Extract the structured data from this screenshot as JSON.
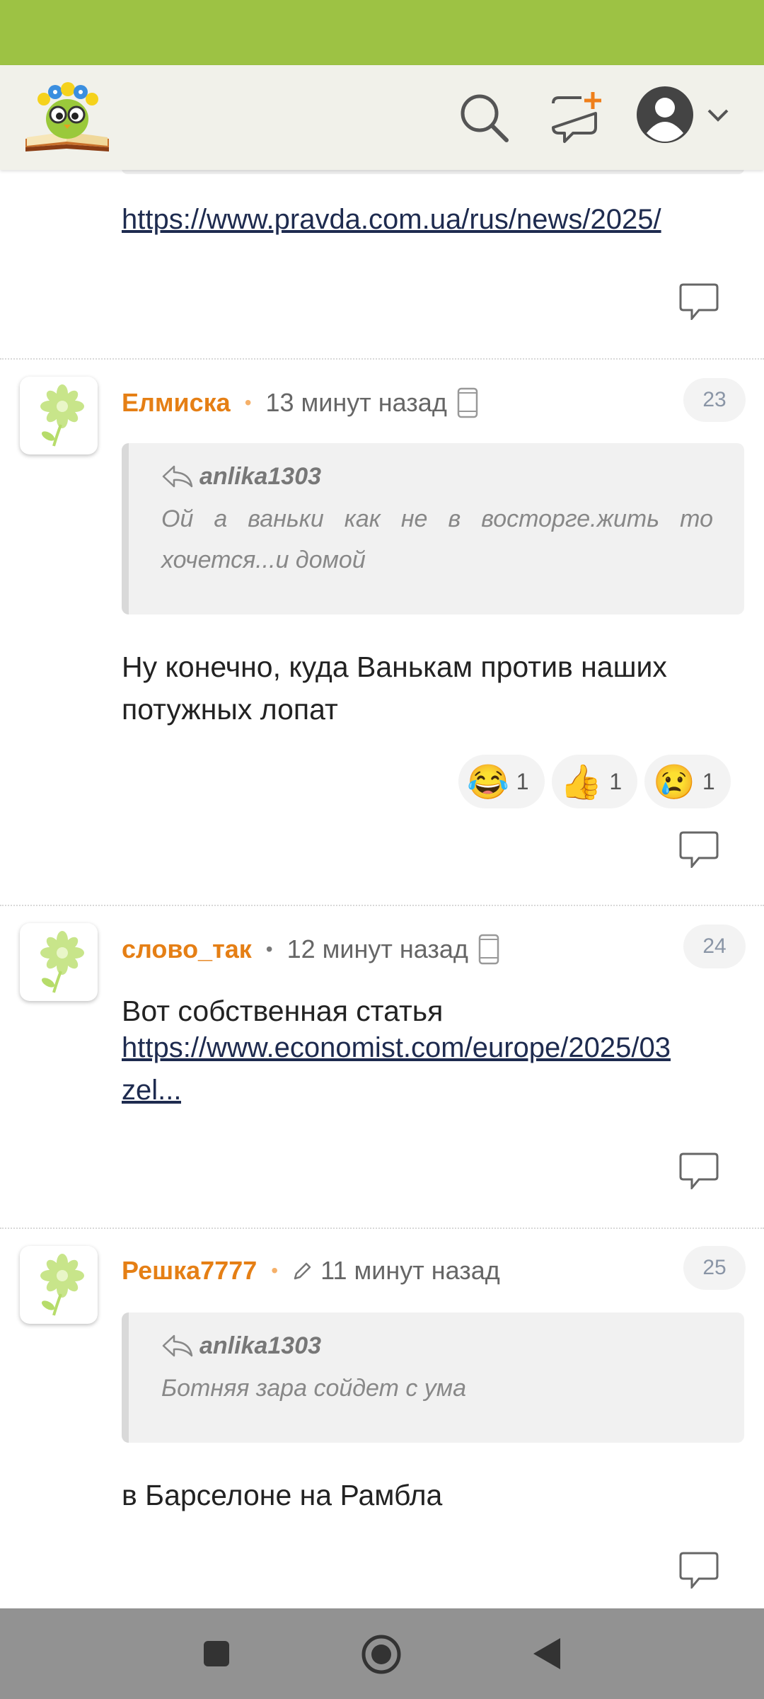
{
  "header": {
    "logo": "book-owl-flowers-logo",
    "icons": [
      "search-icon",
      "new-post-icon",
      "account-avatar-icon",
      "chevron-down-icon"
    ]
  },
  "colors": {
    "status_bar": "#9dc244",
    "header_bg": "#f1f1ea",
    "author": "#e57f15",
    "link": "#1e2b4f",
    "nav_bar": "#929292"
  },
  "feed": {
    "prev_comment_link": "https://www.pravda.com.ua/rus/news/2025/",
    "comments": [
      {
        "author": "Елмиска",
        "time": "13 минут назад",
        "number": "23",
        "quote_author": "anlika1303",
        "quote_text": "Ой а ваньки как не в восторге.жить то хочется...и домой",
        "text": "Ну конечно, куда Ванькам против наших потужных лопат",
        "reactions": [
          {
            "emoji": "😂",
            "count": "1"
          },
          {
            "emoji": "👍",
            "count": "1"
          },
          {
            "emoji": "😢",
            "count": "1"
          }
        ]
      },
      {
        "author": "слово_так",
        "time": "12 минут назад",
        "number": "24",
        "text": "Вот собственная статья",
        "link_line1": "https://www.economist.com/europe/2025/03",
        "link_line2": "zel..."
      },
      {
        "author": "Решка7777",
        "time": "11 минут назад",
        "number": "25",
        "quote_author": "anlika1303",
        "quote_text": "Ботняя зара сойдет с ума",
        "text": "в Барселоне на Рамбла"
      }
    ]
  }
}
